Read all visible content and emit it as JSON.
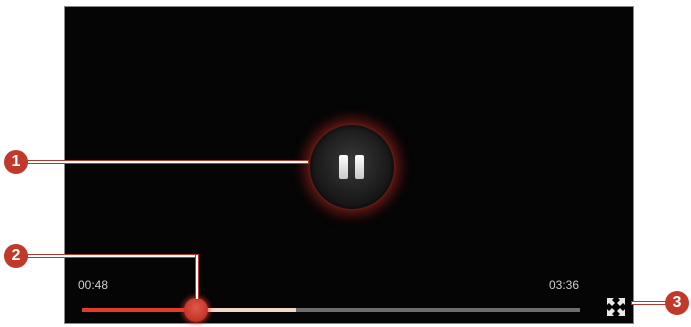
{
  "player": {
    "state": "playing",
    "elapsed_time": "00:48",
    "total_time": "03:36",
    "progress_fraction": 0.228,
    "buffered_fraction": 0.43
  },
  "controls": {
    "pause_icon": "pause-icon",
    "fullscreen_icon": "fullscreen-icon"
  },
  "callouts": {
    "c1": "1",
    "c2": "2",
    "c3": "3"
  },
  "colors": {
    "accent": "#e43a2c",
    "callout": "#c0392b",
    "buffered": "#f3d8c8",
    "track": "#6e6e6e",
    "background": "#050505"
  }
}
